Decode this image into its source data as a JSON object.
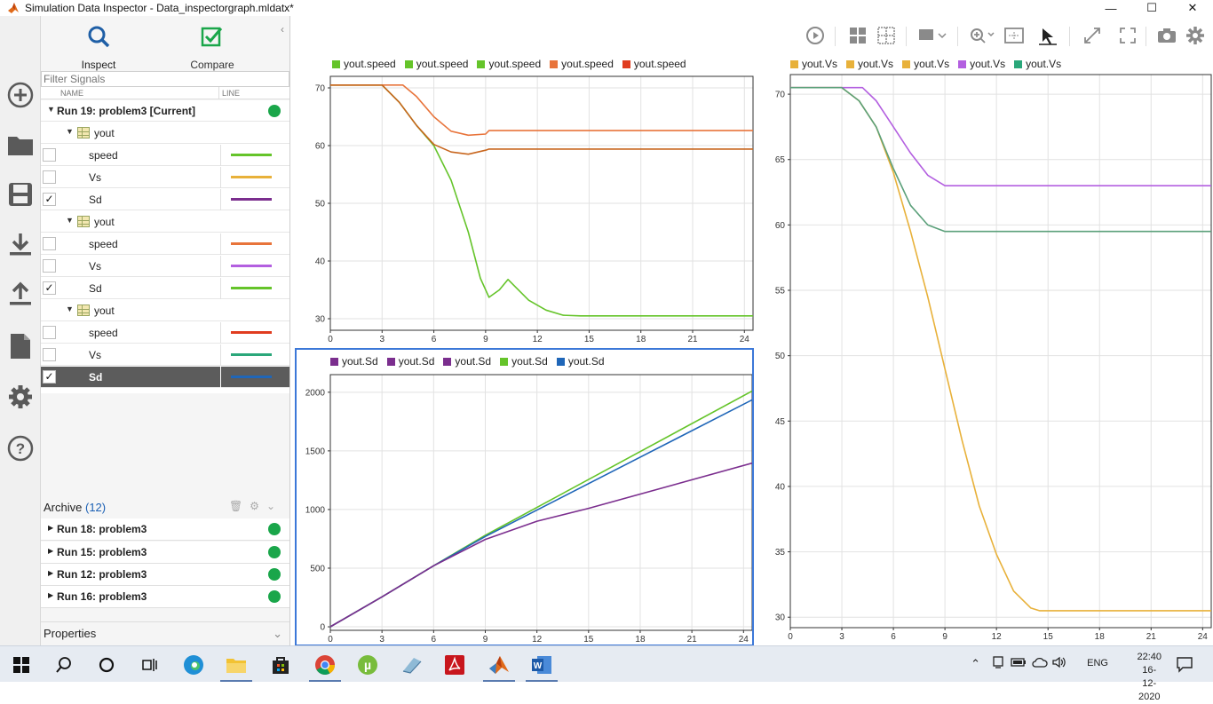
{
  "window": {
    "title": "Simulation Data Inspector - Data_inspectorgraph.mldatx*",
    "controls": [
      "minimize",
      "maximize",
      "close"
    ]
  },
  "leftbar": {
    "icons": [
      "add-icon",
      "folder-icon",
      "save-icon",
      "download-icon",
      "upload-icon",
      "document-icon",
      "gear-icon",
      "help-icon"
    ]
  },
  "tabs": {
    "inspect": "Inspect",
    "compare": "Compare"
  },
  "filter": {
    "placeholder": "Filter Signals"
  },
  "columns": {
    "name": "NAME",
    "line": "LINE"
  },
  "run_current": {
    "label": "Run 19: problem3 [Current]",
    "status_color": "#1aa64a"
  },
  "groups": [
    {
      "label": "yout",
      "signals": [
        {
          "name": "speed",
          "checked": false,
          "color": "#65c42a"
        },
        {
          "name": "Vs",
          "checked": false,
          "color": "#e8b13a"
        },
        {
          "name": "Sd",
          "checked": true,
          "color": "#7b2e8e"
        }
      ]
    },
    {
      "label": "yout",
      "signals": [
        {
          "name": "speed",
          "checked": false,
          "color": "#e8743b"
        },
        {
          "name": "Vs",
          "checked": false,
          "color": "#b35fe0"
        },
        {
          "name": "Sd",
          "checked": true,
          "color": "#65c42a"
        }
      ]
    },
    {
      "label": "yout",
      "signals": [
        {
          "name": "speed",
          "checked": false,
          "color": "#e03c1f"
        },
        {
          "name": "Vs",
          "checked": false,
          "color": "#2aa77a"
        },
        {
          "name": "Sd",
          "checked": true,
          "color": "#1f66b8",
          "selected": true
        }
      ]
    }
  ],
  "archive": {
    "label": "Archive",
    "count": "(12)",
    "runs": [
      {
        "label": "Run 18: problem3"
      },
      {
        "label": "Run 15: problem3"
      },
      {
        "label": "Run 12: problem3"
      },
      {
        "label": "Run 16: problem3"
      }
    ]
  },
  "properties": {
    "label": "Properties"
  },
  "toolbar": {
    "icons": [
      "play-icon",
      "layout-icon",
      "subplot-icon",
      "marker-icon",
      "zoom-icon",
      "fit-icon",
      "cursor-icon",
      "expand-icon",
      "fullscreen-icon",
      "camera-icon",
      "settings-icon"
    ]
  },
  "chart_data": [
    {
      "type": "line",
      "legend": [
        "yout.speed",
        "yout.speed",
        "yout.speed",
        "yout.speed",
        "yout.speed"
      ],
      "legend_colors": [
        "#65c42a",
        "#65c42a",
        "#65c42a",
        "#e8743b",
        "#e03c1f"
      ],
      "xlim": [
        0,
        24.5
      ],
      "ylim": [
        28,
        72
      ],
      "x_ticks": [
        "0",
        "3",
        "6",
        "9",
        "12",
        "15",
        "18",
        "21",
        "24"
      ],
      "y_ticks": [
        "30",
        "40",
        "50",
        "60",
        "70"
      ],
      "grid": true,
      "series": [
        {
          "color": "#65c42a",
          "x": [
            0,
            3,
            4,
            5,
            6,
            7,
            8,
            8.7,
            9.2,
            9.8,
            10.3,
            10.8,
            11.5,
            12.5,
            13.5,
            14.5,
            24.5
          ],
          "y": [
            70.5,
            70.5,
            67.5,
            63.5,
            60,
            54,
            45,
            37,
            33.7,
            35,
            36.8,
            35.3,
            33.2,
            31.5,
            30.6,
            30.5,
            30.5
          ]
        },
        {
          "color": "#e8743b",
          "x": [
            0,
            4.2,
            5,
            6,
            7,
            8,
            9,
            9.2,
            24.5
          ],
          "y": [
            70.5,
            70.5,
            68.5,
            65,
            62.5,
            61.8,
            62,
            62.6,
            62.6
          ]
        },
        {
          "color": "#c8661e",
          "x": [
            0,
            3,
            4,
            5,
            6,
            7,
            8,
            9,
            9.2,
            24.5
          ],
          "y": [
            70.5,
            70.5,
            67.5,
            63.5,
            60.2,
            58.9,
            58.5,
            59.2,
            59.4,
            59.4
          ]
        }
      ]
    },
    {
      "type": "line",
      "legend": [
        "yout.Sd",
        "yout.Sd",
        "yout.Sd",
        "yout.Sd",
        "yout.Sd"
      ],
      "legend_colors": [
        "#7b2e8e",
        "#7b2e8e",
        "#7b2e8e",
        "#65c42a",
        "#1f66b8"
      ],
      "xlim": [
        0,
        24.5
      ],
      "ylim": [
        -30,
        2150
      ],
      "x_ticks": [
        "0",
        "3",
        "6",
        "9",
        "12",
        "15",
        "18",
        "21",
        "24"
      ],
      "y_ticks": [
        "0",
        "500",
        "1000",
        "1500",
        "2000"
      ],
      "grid": true,
      "series": [
        {
          "color": "#65c42a",
          "x": [
            0,
            3,
            6,
            9,
            24.5
          ],
          "y": [
            0,
            255,
            520,
            780,
            2010
          ]
        },
        {
          "color": "#1f66b8",
          "x": [
            0,
            3,
            6,
            9,
            24.5
          ],
          "y": [
            0,
            255,
            520,
            770,
            1935
          ]
        },
        {
          "color": "#7b2e8e",
          "x": [
            0,
            3,
            6,
            9,
            12,
            15,
            24.5
          ],
          "y": [
            0,
            255,
            520,
            745,
            900,
            1010,
            1395
          ]
        }
      ]
    },
    {
      "type": "line",
      "legend": [
        "yout.Vs",
        "yout.Vs",
        "yout.Vs",
        "yout.Vs",
        "yout.Vs"
      ],
      "legend_colors": [
        "#e8b13a",
        "#e8b13a",
        "#e8b13a",
        "#b35fe0",
        "#2aa77a"
      ],
      "xlim": [
        0,
        24.5
      ],
      "ylim": [
        29.2,
        71.5
      ],
      "x_ticks": [
        "0",
        "3",
        "6",
        "9",
        "12",
        "15",
        "18",
        "21",
        "24"
      ],
      "y_ticks": [
        "30",
        "35",
        "40",
        "45",
        "50",
        "55",
        "60",
        "65",
        "70"
      ],
      "grid": true,
      "series": [
        {
          "color": "#e8b13a",
          "x": [
            0,
            3,
            4,
            5,
            6,
            7,
            8,
            9,
            10,
            11,
            12,
            13,
            14,
            14.5,
            24.5
          ],
          "y": [
            70.5,
            70.5,
            69.5,
            67.5,
            64,
            59.5,
            54.5,
            49,
            43.5,
            38.5,
            34.8,
            32,
            30.7,
            30.5,
            30.5
          ]
        },
        {
          "color": "#b35fe0",
          "x": [
            0,
            4.2,
            5,
            6,
            7,
            8,
            9,
            24.5
          ],
          "y": [
            70.5,
            70.5,
            69.5,
            67.5,
            65.5,
            63.8,
            63,
            63
          ]
        },
        {
          "color": "#5ba07a",
          "x": [
            0,
            3,
            4,
            5,
            6,
            7,
            8,
            9,
            24.5
          ],
          "y": [
            70.5,
            70.5,
            69.5,
            67.5,
            64.3,
            61.5,
            60,
            59.5,
            59.5
          ]
        }
      ]
    }
  ],
  "taskbar": {
    "apps": [
      "windows-start-icon",
      "search-icon",
      "cortana-icon",
      "taskview-icon",
      "edge-icon",
      "file-explorer-icon",
      "store-icon",
      "chrome-icon",
      "utorrent-icon",
      "app-icon",
      "acrobat-icon",
      "matlab-icon",
      "word-icon"
    ],
    "language": "ENG",
    "time": "22:40",
    "date": "16-12-2020"
  }
}
